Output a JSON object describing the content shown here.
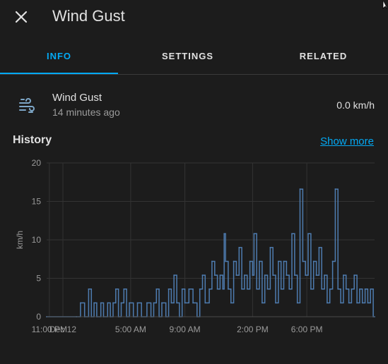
{
  "dialog": {
    "title": "Wind Gust",
    "close_icon": "close-icon"
  },
  "tabs": [
    {
      "label": "INFO",
      "active": true
    },
    {
      "label": "SETTINGS",
      "active": false
    },
    {
      "label": "RELATED",
      "active": false
    }
  ],
  "entity": {
    "icon": "weather-windy-icon",
    "name": "Wind Gust",
    "last_changed": "14 minutes ago",
    "state": "0.0 km/h"
  },
  "history": {
    "title": "History",
    "show_more_label": "Show more"
  },
  "colors": {
    "accent": "#03a9f4",
    "series": "#4e7cb0",
    "background": "#1c1c1c"
  },
  "chart_data": {
    "type": "line",
    "ylabel": "km/h",
    "ylim": [
      0,
      20
    ],
    "y_ticks": [
      "0",
      "5",
      "10",
      "15",
      "20"
    ],
    "x_ticks": [
      "11:00 PM",
      "Dec 12",
      "5:00 AM",
      "9:00 AM",
      "2:00 PM",
      "6:00 PM"
    ],
    "x_tick_hours": [
      -1,
      0,
      5,
      9,
      14,
      18
    ],
    "x_unit": "hours since Dec 12 00:00",
    "x_range": [
      -1.2,
      23.0
    ],
    "series": [
      {
        "name": "",
        "points": [
          [
            -1.2,
            0
          ],
          [
            1.0,
            0
          ],
          [
            1.3,
            1.8
          ],
          [
            1.6,
            0
          ],
          [
            1.9,
            3.6
          ],
          [
            2.1,
            0
          ],
          [
            2.3,
            1.8
          ],
          [
            2.5,
            0
          ],
          [
            2.8,
            1.8
          ],
          [
            3.0,
            0
          ],
          [
            3.3,
            1.8
          ],
          [
            3.5,
            0
          ],
          [
            3.7,
            1.8
          ],
          [
            3.9,
            3.6
          ],
          [
            4.1,
            0
          ],
          [
            4.3,
            1.8
          ],
          [
            4.5,
            3.6
          ],
          [
            4.7,
            0
          ],
          [
            4.9,
            1.8
          ],
          [
            5.2,
            0
          ],
          [
            5.5,
            1.8
          ],
          [
            5.8,
            0
          ],
          [
            6.2,
            1.8
          ],
          [
            6.5,
            0
          ],
          [
            6.7,
            1.8
          ],
          [
            6.9,
            3.6
          ],
          [
            7.1,
            0
          ],
          [
            7.3,
            1.8
          ],
          [
            7.6,
            0
          ],
          [
            7.8,
            3.6
          ],
          [
            8.0,
            1.8
          ],
          [
            8.2,
            5.4
          ],
          [
            8.4,
            1.8
          ],
          [
            8.6,
            0
          ],
          [
            8.8,
            3.6
          ],
          [
            9.0,
            1.8
          ],
          [
            9.3,
            3.6
          ],
          [
            9.6,
            1.8
          ],
          [
            9.9,
            0
          ],
          [
            10.1,
            3.6
          ],
          [
            10.3,
            5.4
          ],
          [
            10.5,
            1.8
          ],
          [
            10.8,
            3.6
          ],
          [
            11.0,
            7.2
          ],
          [
            11.2,
            5.4
          ],
          [
            11.4,
            3.6
          ],
          [
            11.6,
            5.4
          ],
          [
            11.8,
            3.6
          ],
          [
            11.9,
            10.8
          ],
          [
            12.0,
            7.2
          ],
          [
            12.2,
            3.6
          ],
          [
            12.4,
            1.8
          ],
          [
            12.6,
            7.2
          ],
          [
            12.8,
            5.4
          ],
          [
            13.0,
            9.0
          ],
          [
            13.2,
            3.6
          ],
          [
            13.4,
            5.4
          ],
          [
            13.6,
            3.6
          ],
          [
            13.8,
            7.2
          ],
          [
            14.0,
            5.4
          ],
          [
            14.1,
            10.8
          ],
          [
            14.3,
            3.6
          ],
          [
            14.5,
            7.2
          ],
          [
            14.7,
            1.8
          ],
          [
            14.9,
            5.4
          ],
          [
            15.1,
            3.6
          ],
          [
            15.3,
            9.0
          ],
          [
            15.5,
            5.4
          ],
          [
            15.7,
            1.8
          ],
          [
            15.9,
            7.2
          ],
          [
            16.1,
            3.6
          ],
          [
            16.3,
            7.2
          ],
          [
            16.5,
            5.4
          ],
          [
            16.7,
            3.6
          ],
          [
            16.9,
            10.8
          ],
          [
            17.1,
            5.4
          ],
          [
            17.3,
            1.8
          ],
          [
            17.5,
            16.6
          ],
          [
            17.7,
            7.2
          ],
          [
            17.9,
            5.4
          ],
          [
            18.1,
            10.8
          ],
          [
            18.3,
            3.6
          ],
          [
            18.5,
            7.2
          ],
          [
            18.7,
            5.4
          ],
          [
            18.9,
            9.0
          ],
          [
            19.1,
            3.6
          ],
          [
            19.3,
            5.4
          ],
          [
            19.5,
            1.8
          ],
          [
            19.7,
            3.6
          ],
          [
            19.9,
            7.2
          ],
          [
            20.1,
            16.6
          ],
          [
            20.3,
            3.6
          ],
          [
            20.5,
            1.8
          ],
          [
            20.7,
            5.4
          ],
          [
            20.9,
            3.6
          ],
          [
            21.1,
            1.8
          ],
          [
            21.3,
            3.6
          ],
          [
            21.5,
            5.4
          ],
          [
            21.7,
            1.8
          ],
          [
            21.9,
            3.6
          ],
          [
            22.1,
            1.8
          ],
          [
            22.3,
            3.6
          ],
          [
            22.5,
            1.8
          ],
          [
            22.7,
            3.6
          ],
          [
            22.9,
            0
          ],
          [
            23.0,
            0
          ]
        ]
      }
    ]
  }
}
